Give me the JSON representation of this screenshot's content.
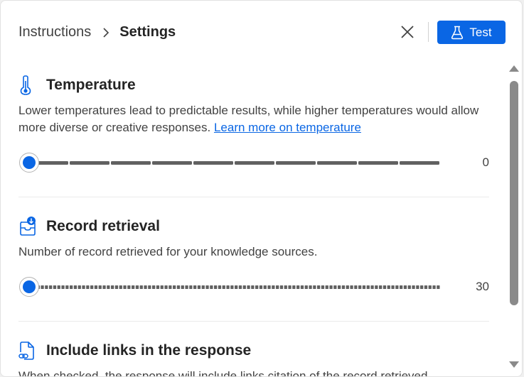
{
  "breadcrumb": {
    "parent": "Instructions",
    "current": "Settings"
  },
  "header": {
    "close_icon": "close-icon",
    "test_label": "Test",
    "test_icon": "flask-icon"
  },
  "sections": [
    {
      "icon": "thermometer-icon",
      "title": "Temperature",
      "description": "Lower temperatures lead to predictable results, while higher temperatures would allow more diverse or creative responses. ",
      "link": "Learn more on temperature",
      "slider_value": "0",
      "slider_steps": 10
    },
    {
      "icon": "record-download-icon",
      "title": "Record retrieval",
      "description": "Number of record retrieved for your knowledge sources.",
      "slider_value": "30",
      "slider_steps": 100
    },
    {
      "icon": "document-link-icon",
      "title": "Include links in the response",
      "description": "When checked, the response will include links citation of the record retrieved"
    }
  ],
  "colors": {
    "accent": "#0a66e4",
    "track": "#616161"
  }
}
